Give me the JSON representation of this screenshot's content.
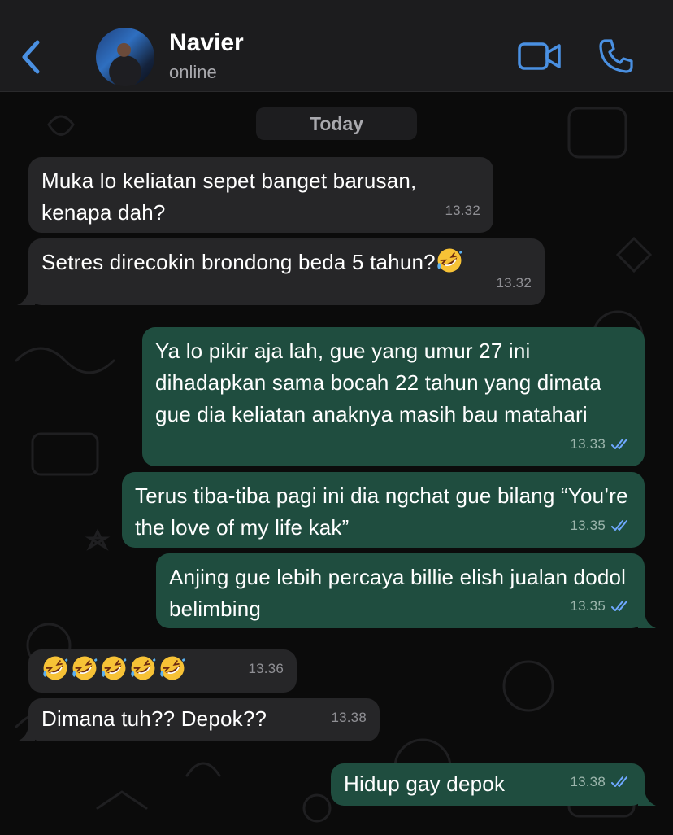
{
  "header": {
    "contact_name": "Navier",
    "contact_status": "online",
    "accent_color": "#4a90e2"
  },
  "chat": {
    "date_separator": "Today",
    "messages": [
      {
        "direction": "incoming",
        "text": "Muka lo keliatan sepet banget barusan, kenapa dah?",
        "time": "13.32"
      },
      {
        "direction": "incoming",
        "text": "Setres direcokin brondong beda 5 tahun?",
        "emoji": "rolling-on-the-floor-laughing",
        "time": "13.32"
      },
      {
        "direction": "outgoing",
        "text": "Ya lo pikir aja lah, gue yang umur 27 ini dihadapkan sama bocah 22 tahun yang dimata gue dia keliatan anaknya masih bau matahari",
        "time": "13.33",
        "status": "read"
      },
      {
        "direction": "outgoing",
        "text": "Terus tiba-tiba pagi ini dia ngchat gue bilang “You’re the love of my life kak”",
        "time": "13.35",
        "status": "read"
      },
      {
        "direction": "outgoing",
        "text": "Anjing gue lebih percaya billie elish jualan dodol belimbing",
        "time": "13.35",
        "status": "read"
      },
      {
        "direction": "incoming",
        "emoji_count": 5,
        "emoji": "rolling-on-the-floor-laughing",
        "time": "13.36"
      },
      {
        "direction": "incoming",
        "text": "Dimana tuh?? Depok??",
        "time": "13.38"
      },
      {
        "direction": "outgoing",
        "text": "Hidup gay depok",
        "time": "13.38",
        "status": "read"
      }
    ]
  },
  "icons": [
    "back-icon",
    "video-call-icon",
    "phone-icon",
    "double-check-icon",
    "rofl-emoji"
  ],
  "colors": {
    "incoming_bubble": "#262628",
    "outgoing_bubble": "#1f4d3f",
    "read_ticks": "#6fa8ff"
  }
}
